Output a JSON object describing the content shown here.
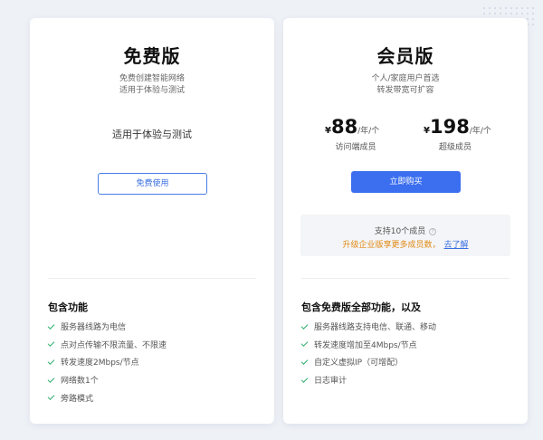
{
  "free_plan": {
    "title": "免费版",
    "desc_line1": "免费创建智能网络",
    "desc_line2": "适用于体验与测试",
    "note": "适用于体验与测试",
    "button_label": "免费使用",
    "features_title": "包含功能",
    "features": [
      "服务器线路为电信",
      "点对点传输不限流量、不限速",
      "转发速度2Mbps/节点",
      "网络数1个",
      "旁路模式"
    ]
  },
  "member_plan": {
    "title": "会员版",
    "desc_line1": "个人/家庭用户首选",
    "desc_line2": "转发带宽可扩容",
    "prices": [
      {
        "currency": "¥",
        "amount": "88",
        "unit": "/年/个",
        "label": "访问端成员"
      },
      {
        "currency": "¥",
        "amount": "198",
        "unit": "/年/个",
        "label": "超级成员"
      }
    ],
    "button_label": "立即购买",
    "info_members": "支持10个成员",
    "info_upgrade": "升级企业版享更多成员数，",
    "info_link": "去了解",
    "features_title": "包含免费版全部功能，以及",
    "features": [
      "服务器线路支持电信、联通、移动",
      "转发速度增加至4Mbps/节点",
      "自定义虚拟IP（可增配）",
      "日志审计"
    ]
  },
  "colors": {
    "primary": "#3b6ff0",
    "check": "#2fb06e",
    "warning": "#e08a16",
    "background": "#eef1f6"
  }
}
